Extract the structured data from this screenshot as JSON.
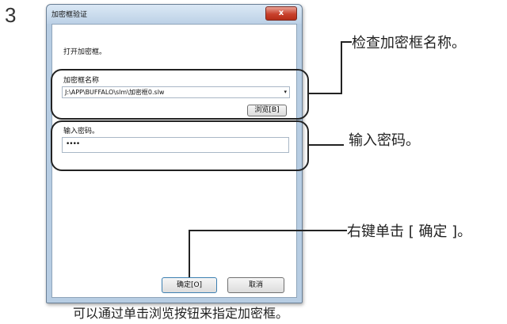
{
  "step_number": "3",
  "dialog": {
    "title": "加密框验证",
    "close_glyph": "x",
    "instruction": "打开加密框。",
    "file_label": "加密框名称",
    "file_path": "J:\\APP\\BUFFALO\\slm\\加密框0.slw",
    "dropdown_arrow": "▾",
    "browse_button": "浏览[B]",
    "password_label": "输入密码。",
    "password_value": "••••",
    "ok_button": "确定[O]",
    "cancel_button": "取消"
  },
  "callouts": {
    "check_name": "检查加密框名称。",
    "enter_password": "输入密码。",
    "right_click_ok": "右键单击 [ 确定 ]。"
  },
  "caption": "可以通过单击浏览按钮来指定加密框。"
}
